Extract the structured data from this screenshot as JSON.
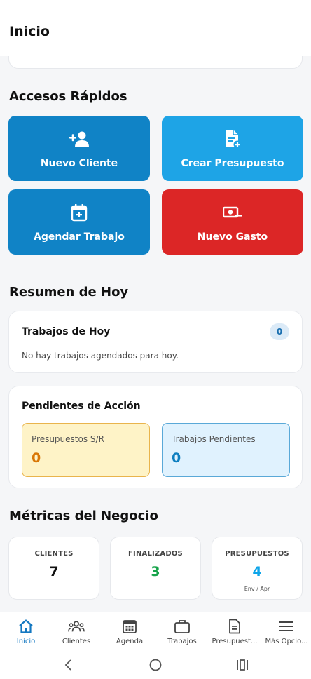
{
  "header": {
    "title": "Inicio"
  },
  "quick_access": {
    "title": "Accesos Rápidos",
    "buttons": [
      {
        "label": "Nuevo Cliente",
        "icon": "user-plus-icon",
        "color": "#1083c6"
      },
      {
        "label": "Crear Presupuesto",
        "icon": "document-plus-icon",
        "color": "#1ea4e6"
      },
      {
        "label": "Agendar Trabajo",
        "icon": "calendar-plus-icon",
        "color": "#1083c6"
      },
      {
        "label": "Nuevo Gasto",
        "icon": "money-minus-icon",
        "color": "#dc2626"
      }
    ]
  },
  "today": {
    "title": "Resumen de Hoy",
    "jobs_title": "Trabajos de Hoy",
    "jobs_count": "0",
    "empty_text": "No hay trabajos agendados para hoy."
  },
  "pending": {
    "title": "Pendientes de Acción",
    "quotes_label": "Presupuestos S/R",
    "quotes_value": "0",
    "jobs_label": "Trabajos Pendientes",
    "jobs_value": "0"
  },
  "metrics": {
    "title": "Métricas del Negocio",
    "clients_label": "CLIENTES",
    "clients_value": "7",
    "finished_label": "FINALIZADOS",
    "finished_value": "3",
    "quotes_label": "PRESUPUESTOS",
    "quotes_value": "4",
    "quotes_sub": "Env / Apr",
    "colors": {
      "clients": "#111111",
      "finished": "#16a34a",
      "quotes": "#0ea5e9"
    }
  },
  "bottom_nav": {
    "items": [
      {
        "label": "Inicio",
        "icon": "home-icon",
        "active": true
      },
      {
        "label": "Clientes",
        "icon": "users-icon"
      },
      {
        "label": "Agenda",
        "icon": "calendar-icon"
      },
      {
        "label": "Trabajos",
        "icon": "briefcase-icon"
      },
      {
        "label": "Presupuest...",
        "icon": "document-icon"
      },
      {
        "label": "Más Opcio...",
        "icon": "menu-icon"
      }
    ]
  },
  "accent_color": "#1478c1"
}
